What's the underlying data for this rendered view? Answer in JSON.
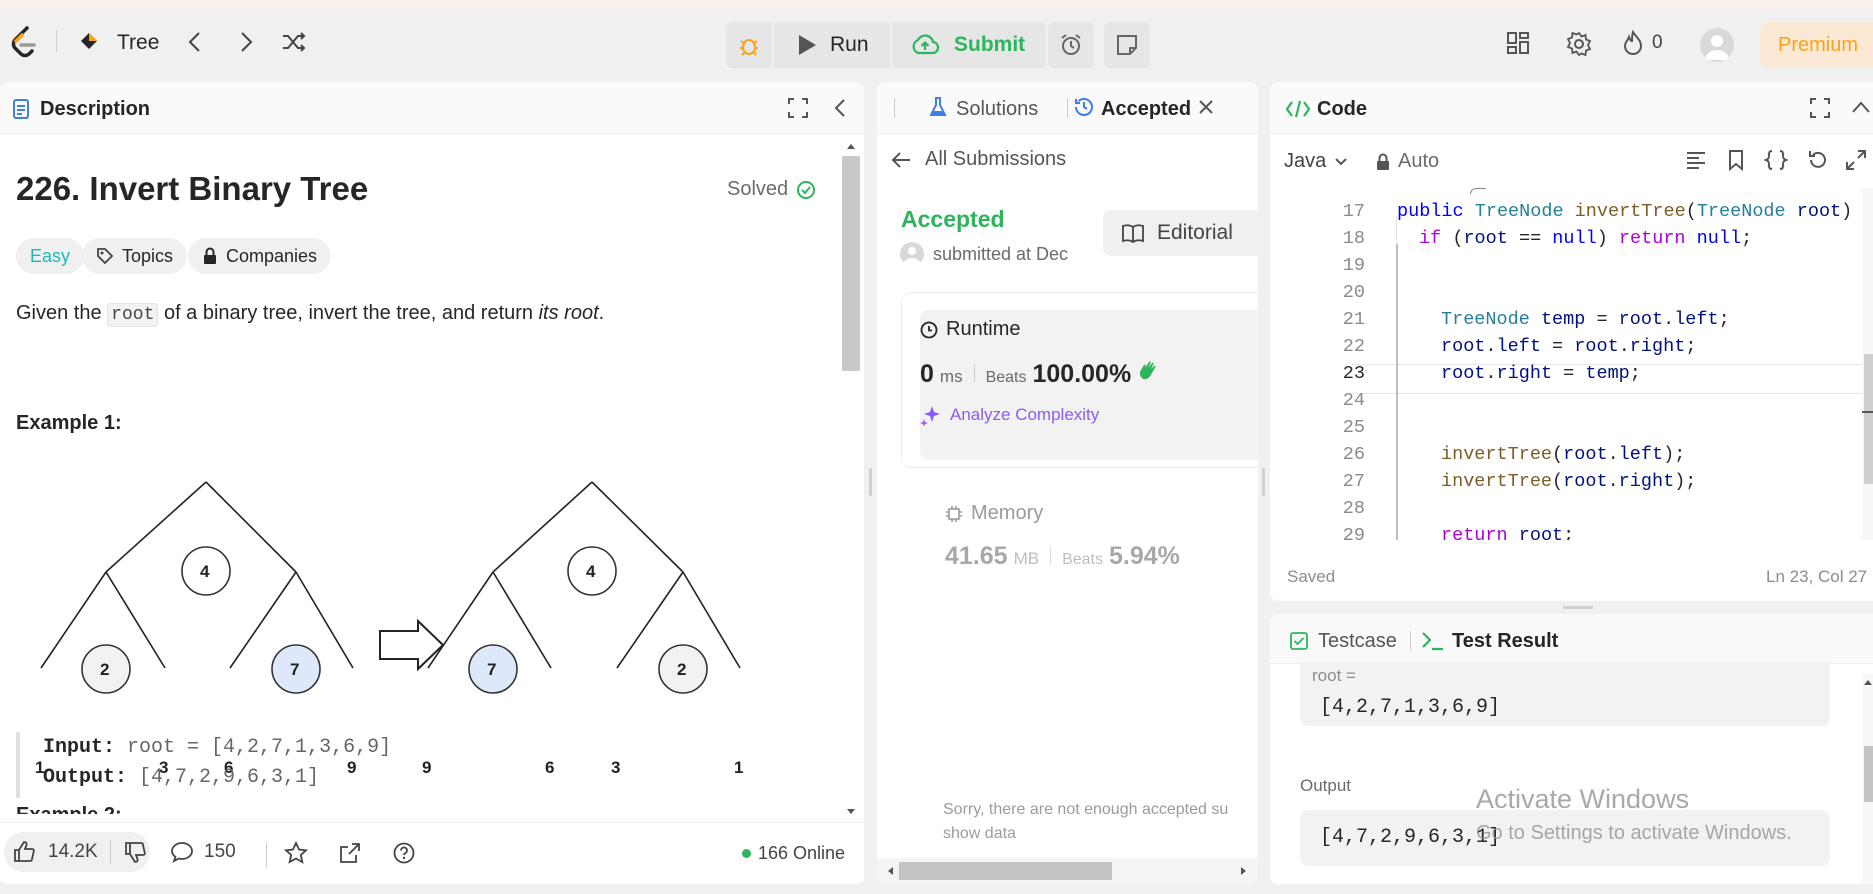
{
  "nav": {
    "problem_title": "Tree",
    "run_label": "Run",
    "submit_label": "Submit",
    "streak_count": "0",
    "premium_label": "Premium"
  },
  "description": {
    "tab_label": "Description",
    "title": "226. Invert Binary Tree",
    "solved_label": "Solved",
    "tags": [
      "Easy",
      "Topics",
      "Companies"
    ],
    "statement_before": "Given the ",
    "statement_code": "root",
    "statement_middle": " of a binary tree, invert the tree, and return ",
    "statement_italic": "its root",
    "statement_end": ".",
    "example_title": "Example 1:",
    "input_label": "Input:",
    "input_value": "root = [4,2,7,1,3,6,9]",
    "output_label": "Output:",
    "output_value": "[4,7,2,9,6,3,1]",
    "next_example_partial": "Example 2:",
    "tree_before": {
      "root": "4",
      "l": "2",
      "r": "7",
      "ll": "1",
      "lr": "3",
      "rl": "6",
      "rr": "9"
    },
    "tree_after": {
      "root": "4",
      "l": "7",
      "r": "2",
      "ll": "9",
      "lr": "6",
      "rl": "3",
      "rr": "1"
    },
    "likes": "14.2K",
    "comments": "150",
    "online": "166 Online"
  },
  "submission": {
    "tab_solutions": "Solutions",
    "tab_accepted": "Accepted",
    "back_label": "All Submissions",
    "status": "Accepted",
    "submitted_text": "submitted at Dec",
    "editorial_label": "Editorial",
    "runtime_label": "Runtime",
    "runtime_value": "0",
    "runtime_unit": "ms",
    "beats_label": "Beats",
    "runtime_beats": "100.00%",
    "analyze_label": "Analyze Complexity",
    "memory_label": "Memory",
    "memory_value": "41.65",
    "memory_unit": "MB",
    "memory_beats": "5.94%",
    "sorry_line1": "Sorry, there are not enough accepted su",
    "sorry_line2": "show data"
  },
  "code": {
    "tab_label": "Code",
    "language": "Java",
    "mode": "Auto",
    "saved_label": "Saved",
    "cursor_pos": "Ln 23, Col 27",
    "line_numbers": [
      "17",
      "18",
      "19",
      "20",
      "21",
      "22",
      "23",
      "24",
      "25",
      "26",
      "27",
      "28",
      "29"
    ]
  },
  "testresult": {
    "tab_testcase": "Testcase",
    "tab_result": "Test Result",
    "root_label": "root =",
    "root_value": "[4,2,7,1,3,6,9]",
    "output_label": "Output",
    "output_value": "[4,7,2,9,6,3,1]",
    "watermark_title": "Activate Windows",
    "watermark_sub": "Go to Settings to activate Windows."
  },
  "colors": {
    "accent_green": "#2db55d",
    "easy": "#1cbaba",
    "premium_text": "#ffa116",
    "link_purple": "#8a5cf5"
  }
}
